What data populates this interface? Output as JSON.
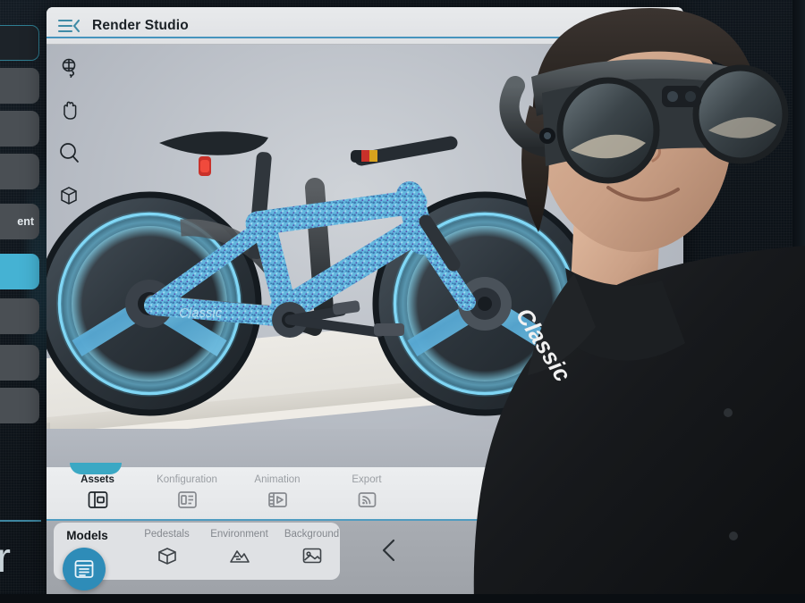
{
  "window": {
    "title": "Render Studio",
    "menu_icon": "collapse-menu-icon"
  },
  "background_app": {
    "partial_label": "ent",
    "wordmark": "er",
    "item_count": 9,
    "active_index": 5,
    "accent_color": "#45b2d3"
  },
  "viewport": {
    "subject": "3d-bicycle-render",
    "frame_text": "Classic",
    "tools": [
      {
        "name": "orbit-tool",
        "icon": "orbit-icon"
      },
      {
        "name": "pan-tool",
        "icon": "hand-icon"
      },
      {
        "name": "zoom-tool",
        "icon": "magnifier-icon"
      },
      {
        "name": "box-tool",
        "icon": "cube-icon"
      }
    ]
  },
  "primary_tabs": [
    {
      "label": "Assets",
      "icon": "panel-layout-icon",
      "active": true
    },
    {
      "label": "Konfiguration",
      "icon": "list-panel-icon",
      "active": false
    },
    {
      "label": "Animation",
      "icon": "film-play-icon",
      "active": false
    },
    {
      "label": "Export",
      "icon": "broadcast-icon",
      "active": false
    }
  ],
  "secondary_tabs": [
    {
      "label": "Models",
      "icon": "window-list-icon",
      "active": true
    },
    {
      "label": "Pedestals",
      "icon": "cube-icon",
      "active": false
    },
    {
      "label": "Environment",
      "icon": "mountains-icon",
      "active": false
    },
    {
      "label": "Background",
      "icon": "image-icon",
      "active": false
    }
  ],
  "navigation": {
    "previous_icon": "chevron-left-icon"
  },
  "person": {
    "description": "person wearing ar-headset",
    "shirt_logo": "Classic"
  },
  "colors": {
    "accent_blue": "#4694bd",
    "accent_teal": "#3ba8c4",
    "fab_blue": "#2e8cb8",
    "panel_light": "#e4e6e8",
    "panel_gray": "#a8acb2"
  }
}
